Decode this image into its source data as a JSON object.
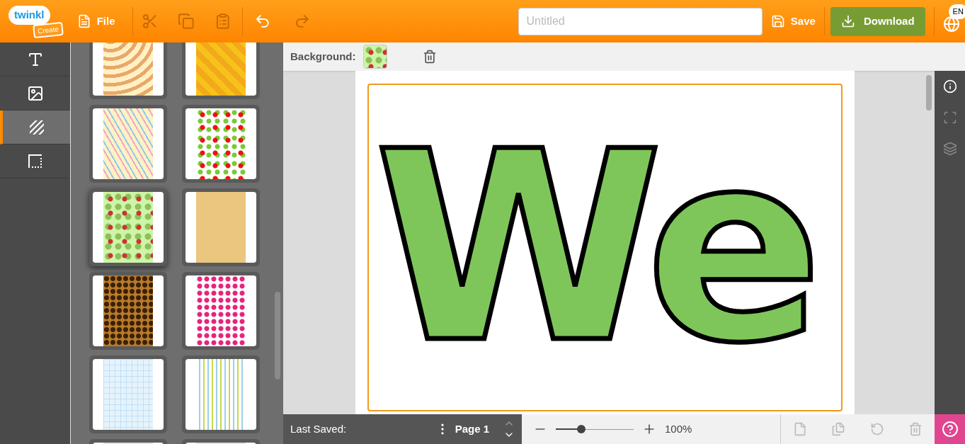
{
  "top_bar": {
    "logo": {
      "name": "twinkl",
      "badge": "Create"
    },
    "file_menu": "File",
    "title_field": {
      "placeholder": "Untitled"
    },
    "save": "Save",
    "download": "Download",
    "language": "EN"
  },
  "tool_rail": [
    {
      "kind": "text",
      "selected": false
    },
    {
      "kind": "image",
      "selected": false
    },
    {
      "kind": "background",
      "selected": true
    },
    {
      "kind": "border",
      "selected": false
    }
  ],
  "backgrounds": [
    {
      "selected": false
    },
    {
      "selected": false
    },
    {
      "selected": false
    },
    {
      "selected": false
    },
    {
      "selected": true
    },
    {
      "selected": false
    },
    {
      "selected": false
    },
    {
      "selected": false
    },
    {
      "selected": false
    },
    {
      "selected": false
    },
    {
      "selected": false
    },
    {
      "selected": false
    }
  ],
  "background_bar": {
    "label": "Background:"
  },
  "canvas": {
    "text": "We"
  },
  "status_bar": {
    "last_saved": "Last Saved:",
    "page": "Page 1",
    "zoom": {
      "level": 0.33,
      "reading": "100%"
    }
  }
}
